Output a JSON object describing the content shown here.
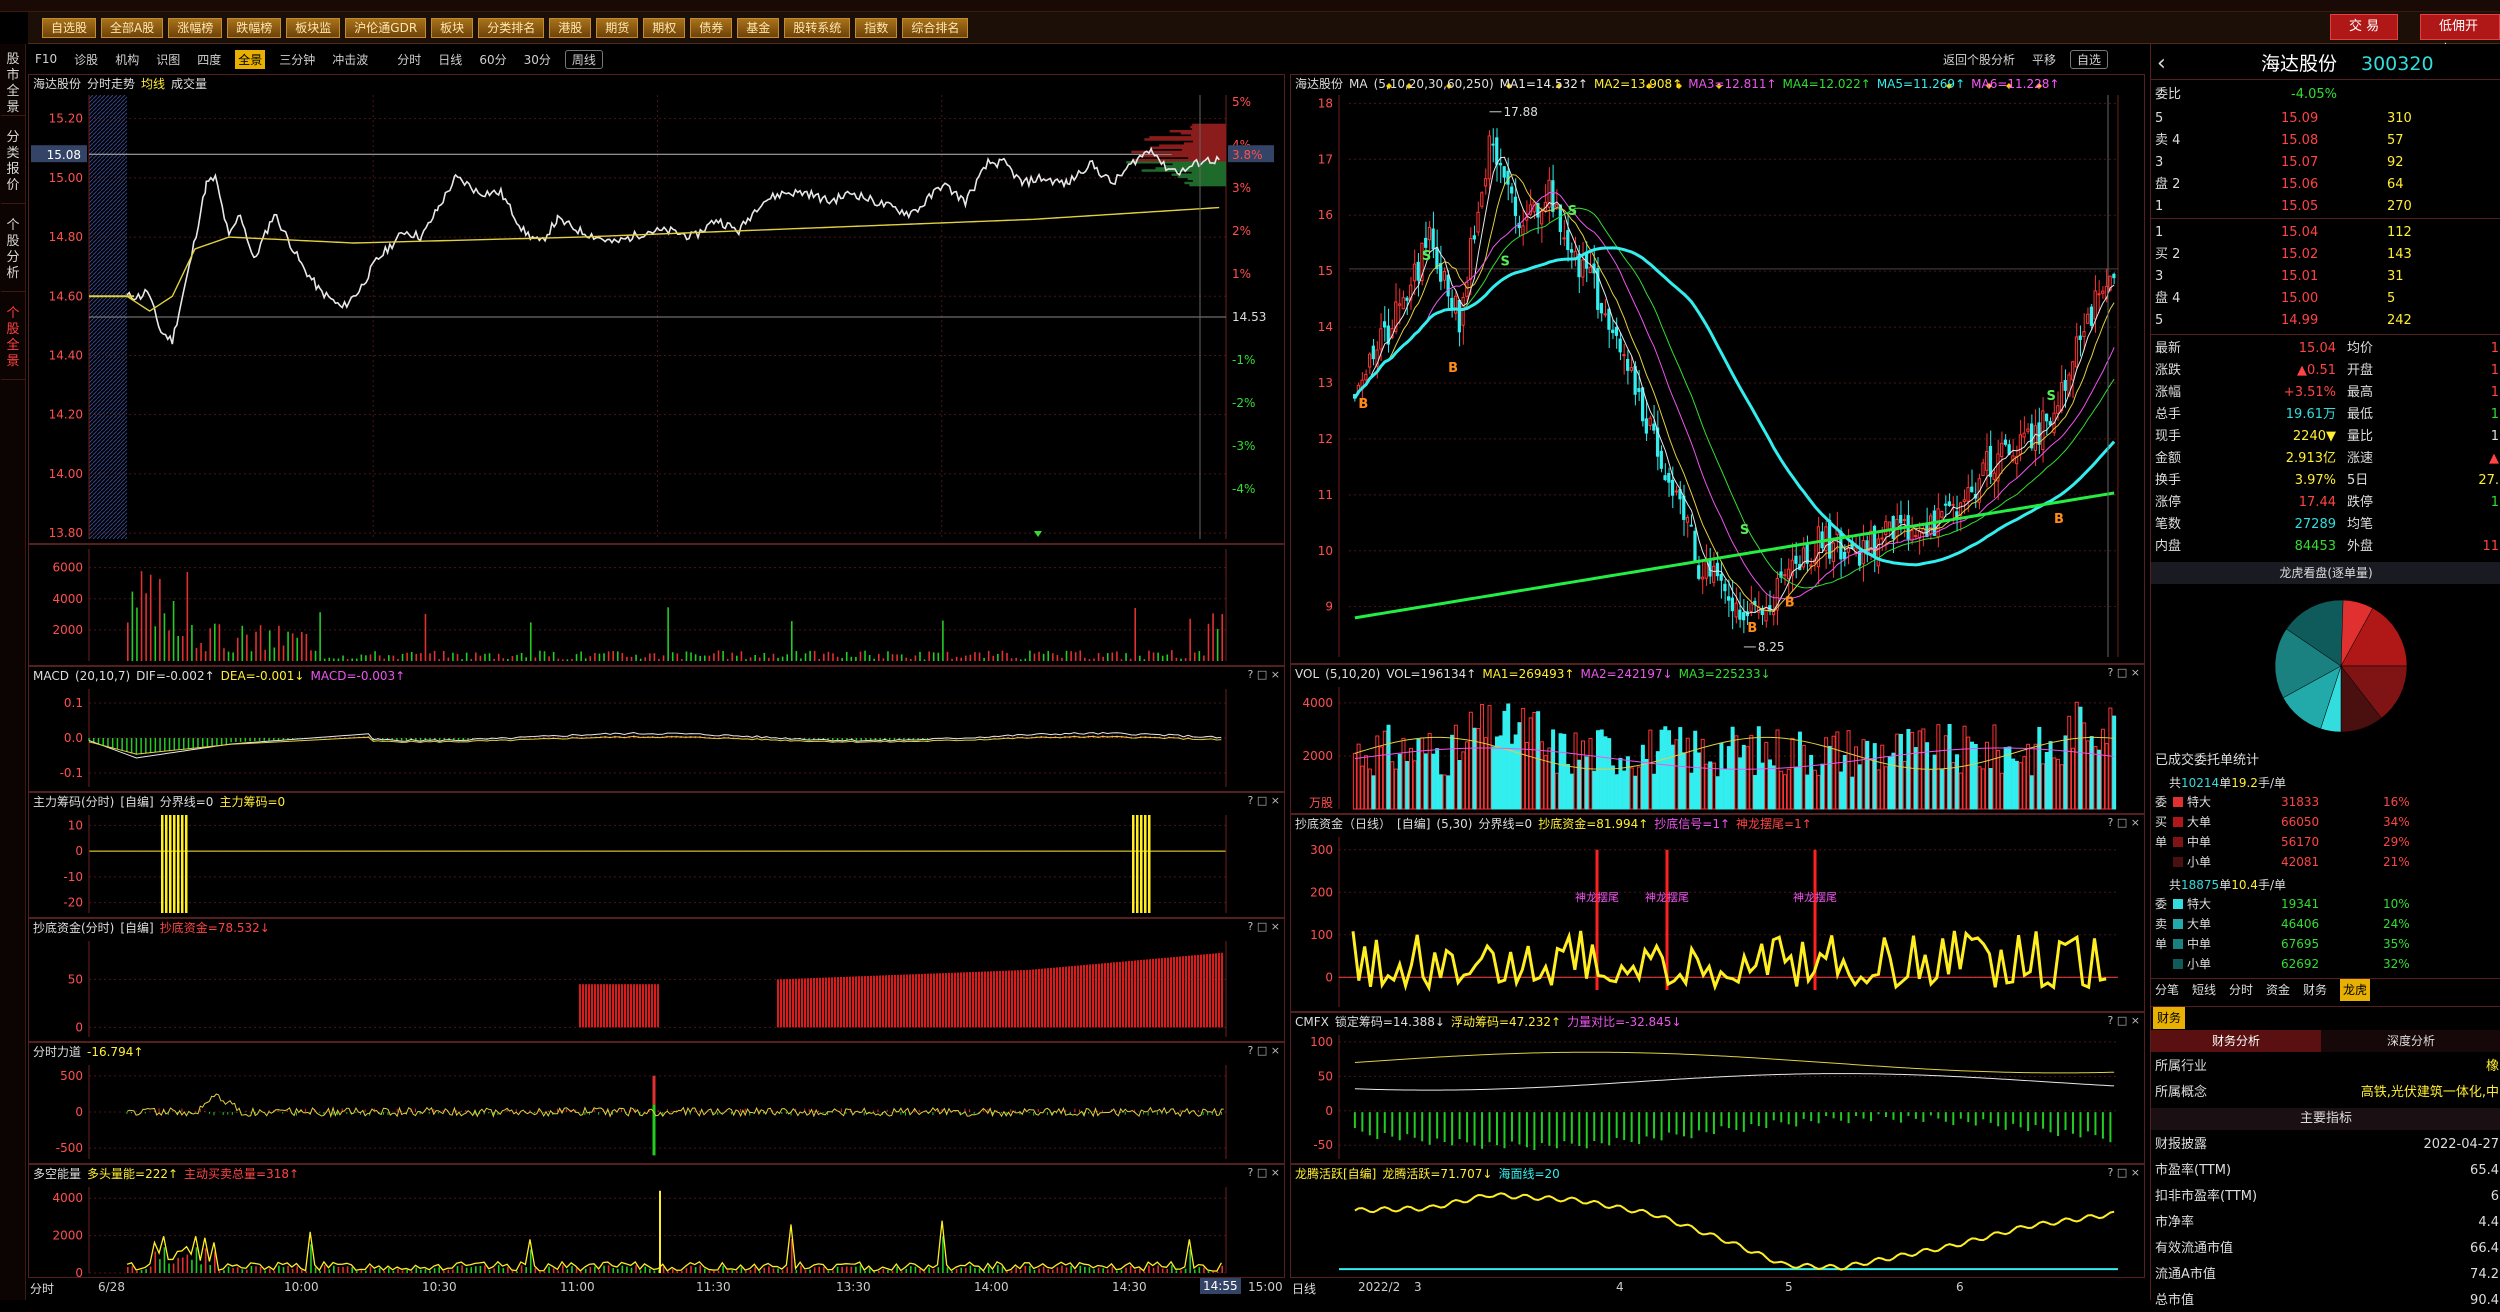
{
  "toolbar": {
    "buttons": [
      "自选股",
      "全部A股",
      "涨幅榜",
      "跌幅榜",
      "板块监",
      "沪伦通GDR",
      "板块",
      "分类排名",
      "港股",
      "期货",
      "期权",
      "债券",
      "基金",
      "股转系统",
      "指数",
      "综合排名"
    ],
    "trade": "交 易",
    "open_account": "低佣开户"
  },
  "leftbar": {
    "tabs": [
      "股市全景",
      "分类报价",
      "个股分析",
      "个股全景"
    ]
  },
  "subtabs": {
    "left": [
      "F10",
      "诊股",
      "机构",
      "识图",
      "四度",
      "全景",
      "三分钟",
      "冲击波"
    ],
    "mid": [
      "分时",
      "日线",
      "60分",
      "30分",
      "周线"
    ],
    "right": [
      "返回个股分析",
      "平移",
      "自选"
    ]
  },
  "intraday": {
    "header": {
      "name": "海达股份",
      "a": "分时走势",
      "b": "均线",
      "c": "成交量"
    },
    "price_ticks": [
      "15.20",
      "15.00",
      "14.80",
      "14.60",
      "14.40",
      "14.20",
      "14.00",
      "13.80"
    ],
    "current_price": "15.08",
    "pct_ticks": [
      "5%",
      "4%",
      "3%",
      "2%",
      "1%",
      "14.53",
      "-1%",
      "-2%",
      "-3%",
      "-4%"
    ],
    "current_pct": "3.8%",
    "vol_ticks": [
      "6000",
      "4000",
      "2000"
    ],
    "macd": {
      "title": "MACD",
      "params": "(20,10,7)",
      "dif": "DIF=-0.002↑",
      "dea": "DEA=-0.001↓",
      "macd": "MACD=-0.003↑",
      "ticks": [
        "0.1",
        "0.0",
        "-0.1"
      ]
    },
    "zlcm": {
      "title": "主力筹码(分时)",
      "mode": "[自编]",
      "fj": "分界线=0",
      "zl": "主力筹码=0",
      "ticks": [
        "10",
        "0",
        "-10",
        "-20"
      ]
    },
    "cdzj": {
      "title": "抄底资金(分时)",
      "mode": "[自编]",
      "v": "抄底资金=78.532↓",
      "ticks": [
        "50",
        "0"
      ]
    },
    "fsld": {
      "title": "分时力道",
      "v": "-16.794↑",
      "ticks": [
        "500",
        "0",
        "-500"
      ]
    },
    "dkn": {
      "title": "多空能量",
      "a": "多头量能=222↑",
      "b": "主动买卖总量=318↑",
      "ticks": [
        "4000",
        "2000",
        "0"
      ]
    },
    "xaxis": {
      "left": "分时",
      "labels": [
        "6/28",
        "10:00",
        "10:30",
        "11:00",
        "11:30",
        "13:30",
        "14:00",
        "14:30",
        "15:00"
      ],
      "now": "14:55"
    }
  },
  "kline": {
    "header": {
      "name": "海达股份",
      "ma": "MA",
      "params": "(5,10,20,30,60,250)",
      "ma1": "MA1=14.532↑",
      "ma2": "MA2=13.908↑",
      "ma3": "MA3=12.811↑",
      "ma4": "MA4=12.022↑",
      "ma5": "MA5=11.269↑",
      "ma6": "MA6=11.228↑"
    },
    "price_ticks": [
      "18",
      "17",
      "16",
      "15",
      "14",
      "13",
      "12",
      "11",
      "10",
      "9"
    ],
    "high": "17.88",
    "low": "8.25",
    "vol": {
      "title": "VOL",
      "params": "(5,10,20)",
      "v": "VOL=196134↑",
      "ma1": "MA1=269493↑",
      "ma2": "MA2=242197↓",
      "ma3": "MA3=225233↓",
      "ticks": [
        "4000",
        "2000",
        "万股"
      ]
    },
    "cdzj": {
      "title": "抄底资金（日线）",
      "mode": "[自编]",
      "params": "(5,30)",
      "fj": "分界线=0",
      "v": "抄底资金=81.994↑",
      "sig1": "抄底信号=1↑",
      "sig2": "神龙摆尾=1↑",
      "label": "神龙摆尾",
      "ticks": [
        "300",
        "200",
        "100",
        "0"
      ]
    },
    "cmfx": {
      "title": "CMFX",
      "a": "锁定筹码=14.388↓",
      "b": "浮动筹码=47.232↑",
      "c": "力量对比=-32.845↓",
      "ticks": [
        "100",
        "50",
        "0",
        "-50"
      ]
    },
    "lths": {
      "title": "龙腾活跃[自编]",
      "a": "龙腾活跃=71.707↓",
      "b": "海面线=20"
    },
    "xaxis": {
      "left": "日线",
      "labels": [
        "2022/2",
        "3",
        "4",
        "5",
        "6"
      ]
    }
  },
  "quote": {
    "name": "海达股份",
    "code": "300320",
    "weibi_label": "委比",
    "weibi": "-4.05%",
    "sell": [
      {
        "label": "5",
        "price": "15.09",
        "vol": "310"
      },
      {
        "label": "卖 4",
        "price": "15.08",
        "vol": "57"
      },
      {
        "label": "3",
        "price": "15.07",
        "vol": "92"
      },
      {
        "label": "盘 2",
        "price": "15.06",
        "vol": "64"
      },
      {
        "label": "1",
        "price": "15.05",
        "vol": "270"
      }
    ],
    "buy": [
      {
        "label": "1",
        "price": "15.04",
        "vol": "112"
      },
      {
        "label": "买 2",
        "price": "15.02",
        "vol": "143"
      },
      {
        "label": "3",
        "price": "15.01",
        "vol": "31"
      },
      {
        "label": "盘 4",
        "price": "15.00",
        "vol": "5"
      },
      {
        "label": "5",
        "price": "14.99",
        "vol": "242"
      }
    ],
    "stats": [
      [
        "最新",
        "15.04",
        "均价",
        "1"
      ],
      [
        "涨跌",
        "▲0.51",
        "开盘",
        "1"
      ],
      [
        "涨幅",
        "+3.51%",
        "最高",
        "1"
      ],
      [
        "总手",
        "19.61万",
        "最低",
        "1"
      ],
      [
        "现手",
        "2240▼",
        "量比",
        "1"
      ],
      [
        "金额",
        "2.913亿",
        "涨速",
        "▲"
      ],
      [
        "换手",
        "3.97%",
        "5日",
        "27."
      ],
      [
        "涨停",
        "17.44",
        "跌停",
        "1"
      ],
      [
        "笔数",
        "27289",
        "均笔",
        ""
      ],
      [
        "内盘",
        "84453",
        "外盘",
        "11"
      ]
    ],
    "pie_title": "龙虎看盘(逐单量)",
    "entrust_title": "已成交委托单统计",
    "buy_summary": {
      "pre": "共",
      "count": "10214",
      "mid": "单",
      "avg": "19.2",
      "post": "手/单"
    },
    "buy_rows": [
      [
        "委",
        "特大",
        "31833",
        "16%"
      ],
      [
        "买",
        "大单",
        "66050",
        "34%"
      ],
      [
        "单",
        "中单",
        "56170",
        "29%"
      ],
      [
        "",
        "小单",
        "42081",
        "21%"
      ]
    ],
    "sell_summary": {
      "pre": "共",
      "count": "18875",
      "mid": "单",
      "avg": "10.4",
      "post": "手/单"
    },
    "sell_rows": [
      [
        "委",
        "特大",
        "19341",
        "10%"
      ],
      [
        "卖",
        "大单",
        "46406",
        "24%"
      ],
      [
        "单",
        "中单",
        "67695",
        "35%"
      ],
      [
        "",
        "小单",
        "62692",
        "32%"
      ]
    ],
    "tabs": [
      "分笔",
      "短线",
      "分时",
      "资金",
      "财务",
      "龙虎"
    ],
    "fin_tab": "财务",
    "fin_sub": [
      "财务分析",
      "深度分析"
    ],
    "industry_label": "所属行业",
    "industry": "橡",
    "concept_label": "所属概念",
    "concept": "高铁,光伏建筑一体化,中",
    "key_title": "主要指标",
    "key_rows": [
      [
        "财报披露",
        "2022-04-27"
      ],
      [
        "市盈率(TTM)",
        "65.4"
      ],
      [
        "扣非市盈率(TTM)",
        "6"
      ],
      [
        "市净率",
        "4.4"
      ],
      [
        "有效流通市值",
        "66.4"
      ],
      [
        "流通A市值",
        "74.2"
      ],
      [
        "总市值",
        "90.4"
      ]
    ]
  },
  "colors": {
    "up": "#ff3333",
    "down": "#33dd33",
    "cyan": "#33eeee",
    "yellow": "#ffee22",
    "grid": "#5a1a1a"
  }
}
